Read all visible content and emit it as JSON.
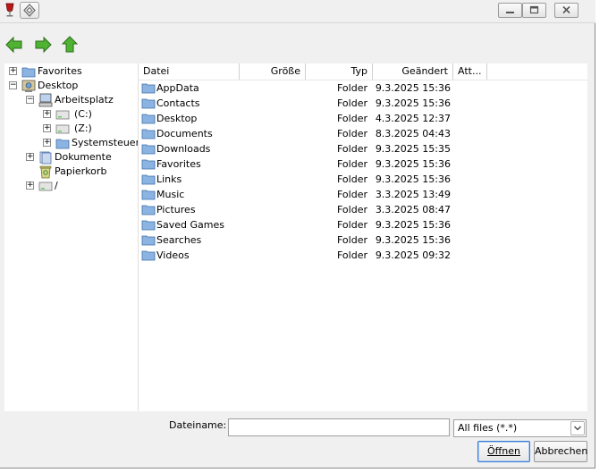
{
  "window": {
    "colors": {
      "frame": "#f0f0f0",
      "pane": "#ffffff",
      "folder": "#7aa7d9",
      "nav_green": "#3fa128"
    }
  },
  "toolbar": {
    "back_icon": "arrow-left-icon",
    "forward_icon": "arrow-right-icon",
    "up_icon": "arrow-up-icon"
  },
  "tree": {
    "items": [
      {
        "label": "Favorites",
        "icon": "folder-icon",
        "expander": "+"
      },
      {
        "label": "Desktop",
        "icon": "desktop-icon",
        "expander": "−"
      },
      {
        "label": "Arbeitsplatz",
        "icon": "computer-icon",
        "expander": "−"
      },
      {
        "label": "(C:)",
        "icon": "drive-icon",
        "expander": "+"
      },
      {
        "label": "(Z:)",
        "icon": "drive-icon",
        "expander": "+"
      },
      {
        "label": "Systemsteueru",
        "icon": "folder-icon",
        "expander": "+"
      },
      {
        "label": "Dokumente",
        "icon": "documents-icon",
        "expander": "+"
      },
      {
        "label": "Papierkorb",
        "icon": "recycle-bin-icon",
        "expander": ""
      },
      {
        "label": "/",
        "icon": "drive-icon",
        "expander": "+"
      }
    ]
  },
  "list": {
    "columns": [
      "Datei",
      "Größe",
      "Typ",
      "Geändert",
      "Att..."
    ],
    "rows": [
      {
        "name": "AppData",
        "size": "",
        "type": "Folder",
        "modified": "9.3.2025 15:36"
      },
      {
        "name": "Contacts",
        "size": "",
        "type": "Folder",
        "modified": "9.3.2025 15:36"
      },
      {
        "name": "Desktop",
        "size": "",
        "type": "Folder",
        "modified": "4.3.2025 12:37"
      },
      {
        "name": "Documents",
        "size": "",
        "type": "Folder",
        "modified": "8.3.2025 04:43"
      },
      {
        "name": "Downloads",
        "size": "",
        "type": "Folder",
        "modified": "9.3.2025 15:35"
      },
      {
        "name": "Favorites",
        "size": "",
        "type": "Folder",
        "modified": "9.3.2025 15:36"
      },
      {
        "name": "Links",
        "size": "",
        "type": "Folder",
        "modified": "9.3.2025 15:36"
      },
      {
        "name": "Music",
        "size": "",
        "type": "Folder",
        "modified": "3.3.2025 13:49"
      },
      {
        "name": "Pictures",
        "size": "",
        "type": "Folder",
        "modified": "3.3.2025 08:47"
      },
      {
        "name": "Saved Games",
        "size": "",
        "type": "Folder",
        "modified": "9.3.2025 15:36"
      },
      {
        "name": "Searches",
        "size": "",
        "type": "Folder",
        "modified": "9.3.2025 15:36"
      },
      {
        "name": "Videos",
        "size": "",
        "type": "Folder",
        "modified": "9.3.2025 09:32"
      }
    ]
  },
  "footer": {
    "filename_label": "Dateiname:",
    "filename_value": "",
    "filter_value": "All files (*.*)",
    "open_label": "Öffnen",
    "cancel_label": "Abbrechen"
  }
}
